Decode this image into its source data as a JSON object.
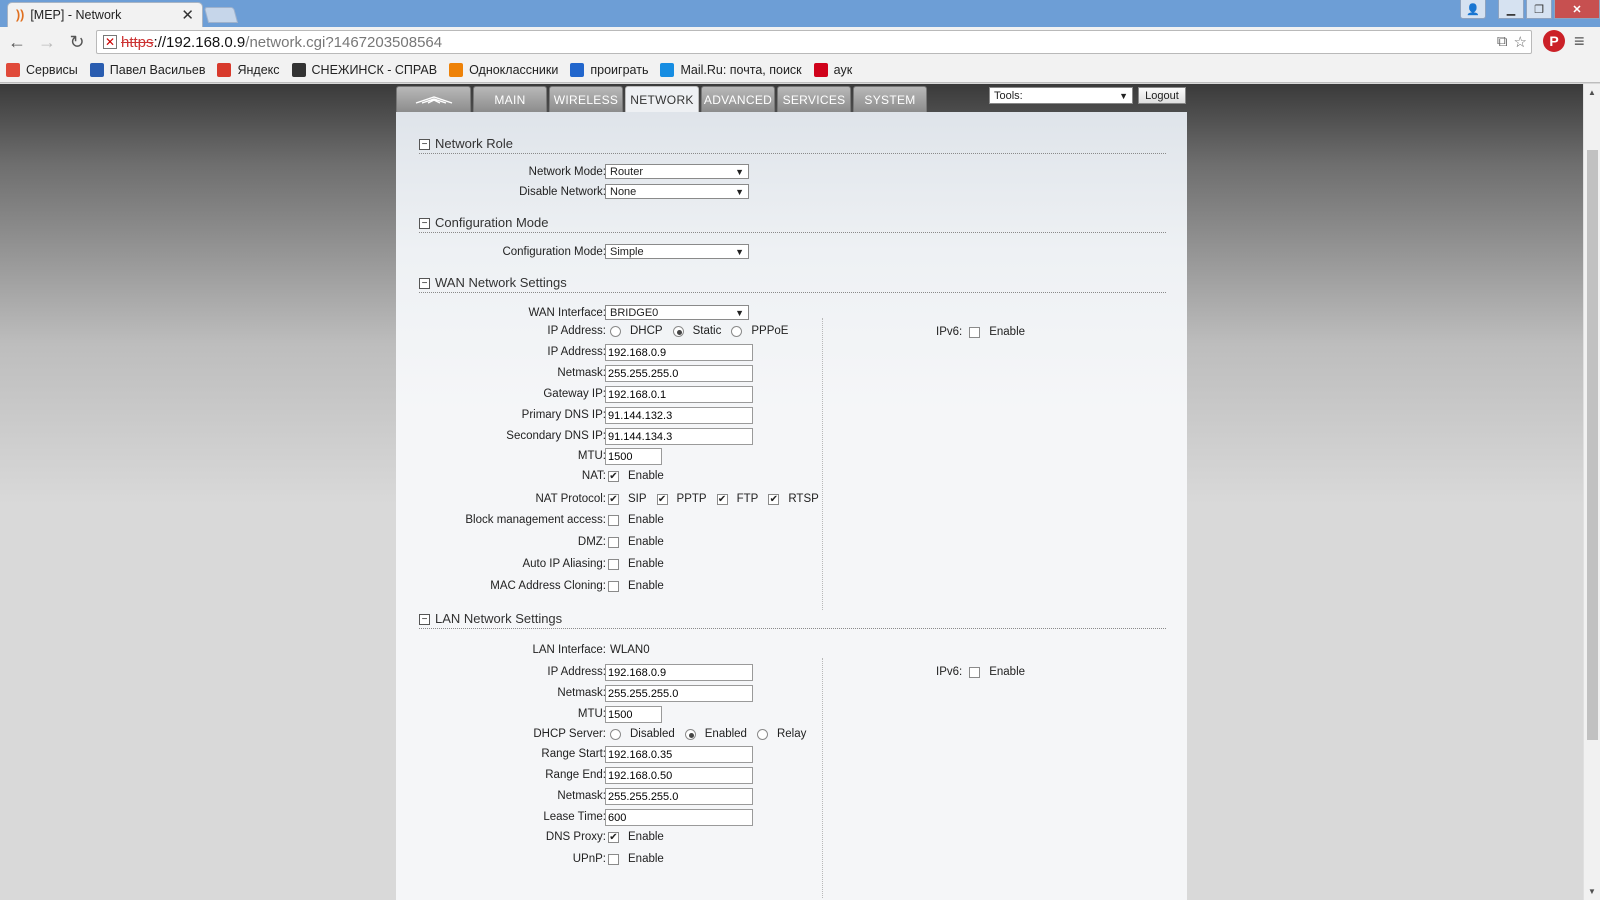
{
  "browser": {
    "tab_title": "[MEP] - Network",
    "url_scheme": "https",
    "url_host": "://192.168.0.9",
    "url_path": "/network.cgi?1467203508564",
    "bookmarks": [
      {
        "label": "Сервисы",
        "icon": "apps-grid-icon",
        "color": "#e04a3a"
      },
      {
        "label": "Павел Васильев",
        "icon": "video-icon",
        "color": "#2a5db0"
      },
      {
        "label": "Яндекс",
        "icon": "yandex-icon",
        "color": "#d83a2c"
      },
      {
        "label": "СНЕЖИНСК - СПРАВ",
        "icon": "city-icon",
        "color": "#333333"
      },
      {
        "label": "Одноклассники",
        "icon": "odnoklassniki-icon",
        "color": "#ee8208"
      },
      {
        "label": "проиграть",
        "icon": "media-icon",
        "color": "#2266cc"
      },
      {
        "label": "Mail.Ru: почта, поиск",
        "icon": "mailru-icon",
        "color": "#168de2"
      },
      {
        "label": "аук",
        "icon": "auction-icon",
        "color": "#d0021b"
      }
    ]
  },
  "nav": {
    "tabs": [
      "MAIN",
      "WIRELESS",
      "NETWORK",
      "ADVANCED",
      "SERVICES",
      "SYSTEM"
    ],
    "active": "NETWORK",
    "tools_label": "Tools:",
    "logout_label": "Logout"
  },
  "network_role": {
    "title": "Network Role",
    "network_mode_label": "Network Mode:",
    "network_mode_value": "Router",
    "disable_network_label": "Disable Network:",
    "disable_network_value": "None"
  },
  "configuration_mode": {
    "title": "Configuration Mode",
    "label": "Configuration Mode:",
    "value": "Simple"
  },
  "wan": {
    "title": "WAN Network Settings",
    "interface_label": "WAN Interface:",
    "interface_value": "BRIDGE0",
    "ip_mode_label": "IP Address:",
    "ip_modes": [
      "DHCP",
      "Static",
      "PPPoE"
    ],
    "ip_mode_selected": "Static",
    "ip_label": "IP Address:",
    "ip_value": "192.168.0.9",
    "netmask_label": "Netmask:",
    "netmask_value": "255.255.255.0",
    "gateway_label": "Gateway IP:",
    "gateway_value": "192.168.0.1",
    "dns1_label": "Primary DNS IP:",
    "dns1_value": "91.144.132.3",
    "dns2_label": "Secondary DNS IP:",
    "dns2_value": "91.144.134.3",
    "mtu_label": "MTU:",
    "mtu_value": "1500",
    "nat_label": "NAT:",
    "nat_enabled": true,
    "nat_protocol_label": "NAT Protocol:",
    "nat_protocols": [
      "SIP",
      "PPTP",
      "FTP",
      "RTSP"
    ],
    "block_mgmt_label": "Block management access:",
    "dmz_label": "DMZ:",
    "auto_ip_label": "Auto IP Aliasing:",
    "mac_clone_label": "MAC Address Cloning:",
    "enable_text": "Enable",
    "ipv6_label": "IPv6:",
    "ipv6_enable": "Enable"
  },
  "lan": {
    "title": "LAN Network Settings",
    "interface_label": "LAN Interface:",
    "interface_value": "WLAN0",
    "ip_label": "IP Address:",
    "ip_value": "192.168.0.9",
    "netmask_label": "Netmask:",
    "netmask_value": "255.255.255.0",
    "mtu_label": "MTU:",
    "mtu_value": "1500",
    "dhcp_label": "DHCP Server:",
    "dhcp_modes": [
      "Disabled",
      "Enabled",
      "Relay"
    ],
    "dhcp_selected": "Enabled",
    "range_start_label": "Range Start:",
    "range_start_value": "192.168.0.35",
    "range_end_label": "Range End:",
    "range_end_value": "192.168.0.50",
    "dhcp_netmask_label": "Netmask:",
    "dhcp_netmask_value": "255.255.255.0",
    "lease_label": "Lease Time:",
    "lease_value": "600",
    "dns_proxy_label": "DNS Proxy:",
    "upnp_label": "UPnP:",
    "enable_text": "Enable",
    "ipv6_label": "IPv6:",
    "ipv6_enable": "Enable"
  }
}
